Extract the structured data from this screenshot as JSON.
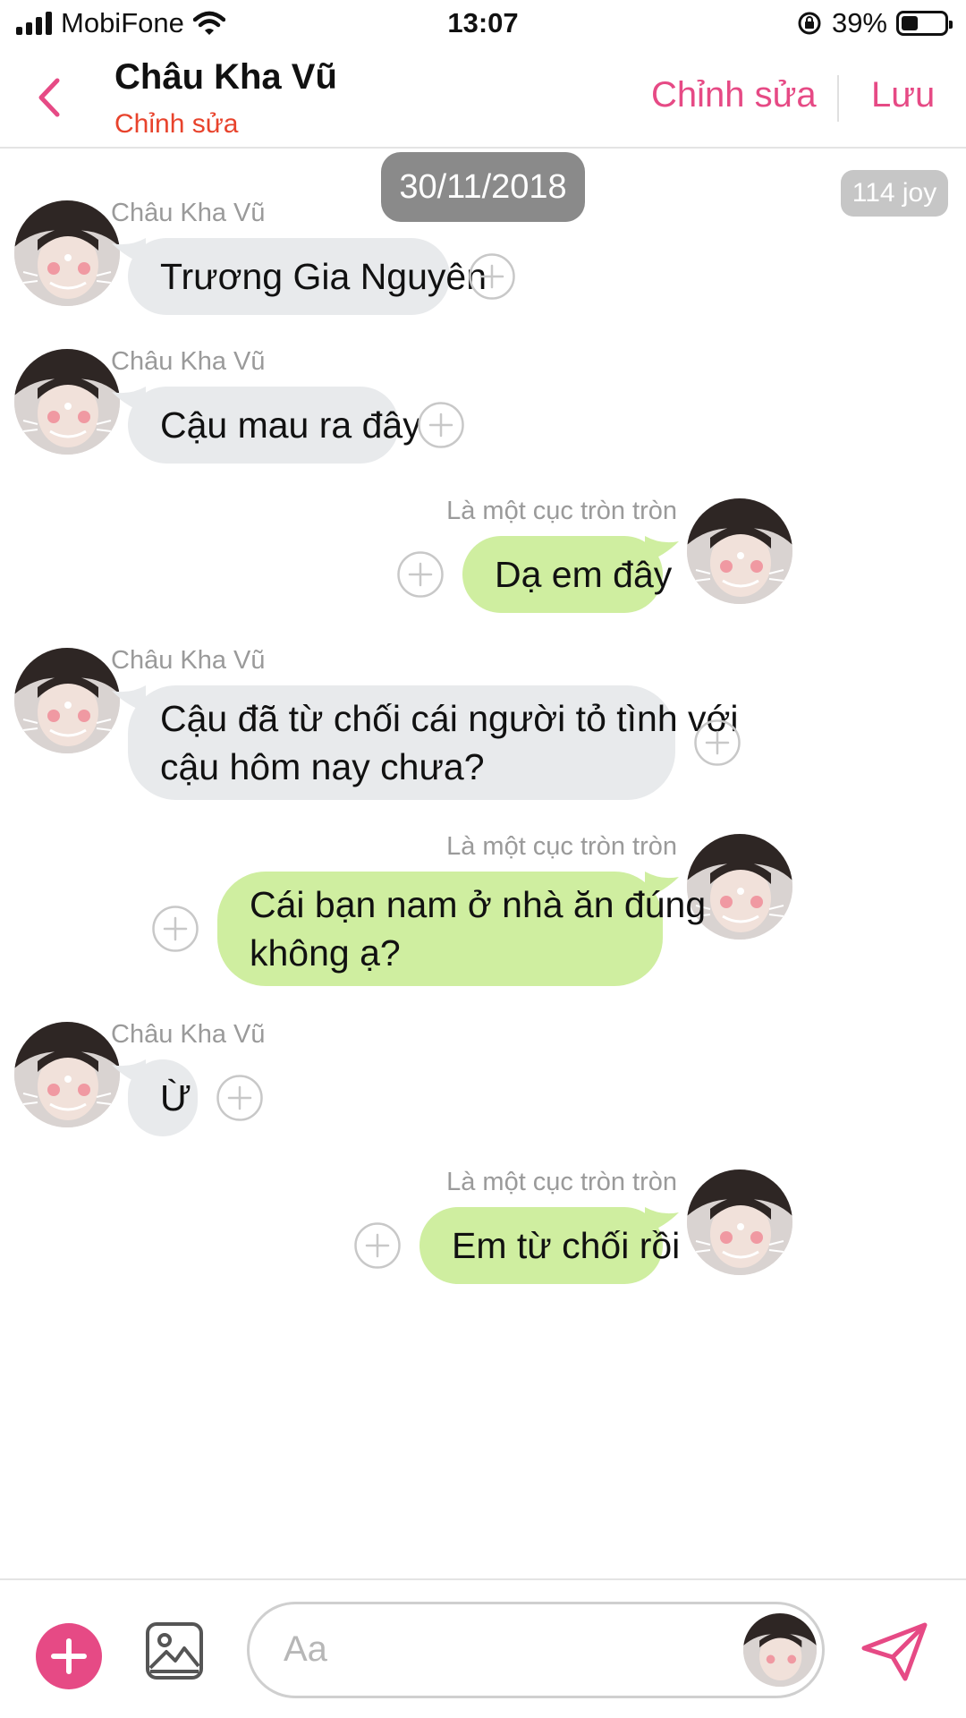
{
  "status_bar": {
    "carrier": "MobiFone",
    "time": "13:07",
    "battery_percent": "39%",
    "battery_level": 0.39,
    "icons": [
      "signal-icon",
      "wifi-icon",
      "orientation-lock-icon",
      "battery-icon"
    ]
  },
  "header": {
    "title": "Châu Kha Vũ",
    "subtitle": "Chỉnh sửa",
    "edit_label": "Chỉnh sửa",
    "save_label": "Lưu",
    "accent_color": "#e64a85",
    "subtitle_color": "#e8432c"
  },
  "date_label": "30/11/2018",
  "joy_label": "114 joy",
  "messages": [
    {
      "side": "incoming",
      "sender": "Châu Kha Vũ",
      "lines": [
        "Trương Gia Nguyên"
      ]
    },
    {
      "side": "incoming",
      "sender": "Châu Kha Vũ",
      "lines": [
        "Cậu mau ra đây"
      ]
    },
    {
      "side": "outgoing",
      "sender": "Là một cục tròn tròn",
      "lines": [
        "Dạ em đây"
      ]
    },
    {
      "side": "incoming",
      "sender": "Châu Kha Vũ",
      "lines": [
        "Cậu đã từ chối cái người tỏ tình với",
        "cậu hôm nay chưa?"
      ]
    },
    {
      "side": "outgoing",
      "sender": "Là một cục tròn tròn",
      "lines": [
        "Cái bạn nam ở nhà ăn đúng",
        "không ạ?"
      ]
    },
    {
      "side": "incoming",
      "sender": "Châu Kha Vũ",
      "lines": [
        "Ừ"
      ]
    },
    {
      "side": "outgoing",
      "sender": "Là một cục tròn tròn",
      "lines": [
        "Em từ chối rồi"
      ]
    }
  ],
  "composer": {
    "placeholder": "Aa"
  },
  "colors": {
    "incoming_bubble": "#e8eaec",
    "outgoing_bubble": "#cfeea0",
    "date_pill": "#8a8a8a",
    "joy_pill": "#c6c6c6"
  }
}
